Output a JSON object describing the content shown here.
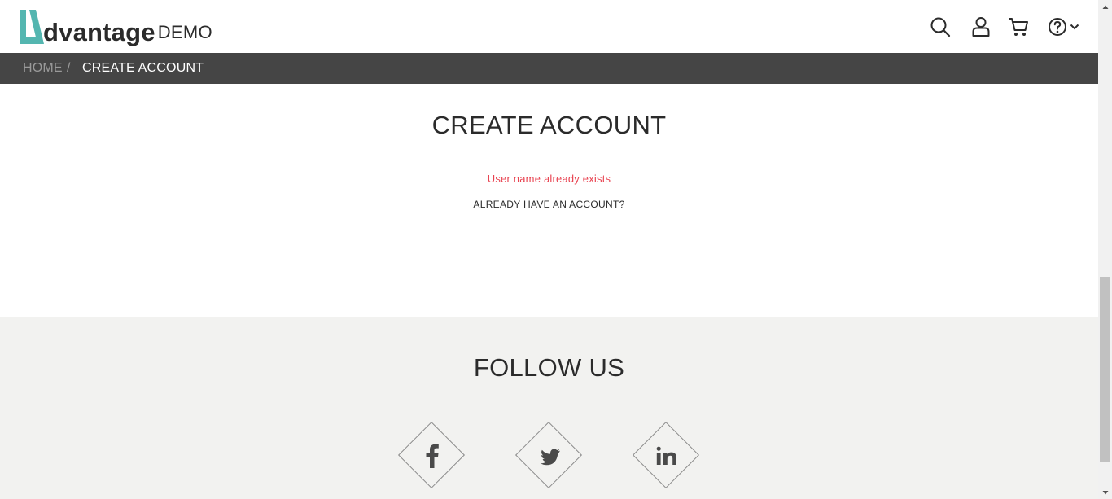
{
  "header": {
    "logo_word": "dvantage",
    "logo_demo": "DEMO",
    "icons": [
      "search-icon",
      "user-icon",
      "cart-icon",
      "help-icon",
      "chevron-down-icon"
    ],
    "accent": "#54b6b0"
  },
  "breadcrumb": {
    "home": "HOME",
    "separator": "/",
    "current": "CREATE ACCOUNT"
  },
  "main": {
    "title": "CREATE ACCOUNT",
    "error": "User name already exists",
    "already_have_account": "ALREADY HAVE AN ACCOUNT?",
    "error_color": "#e8414f"
  },
  "footer": {
    "title": "FOLLOW US",
    "social": [
      {
        "icon": "facebook-icon"
      },
      {
        "icon": "twitter-icon"
      },
      {
        "icon": "linkedin-icon"
      }
    ],
    "background": "#f2f2f0"
  }
}
